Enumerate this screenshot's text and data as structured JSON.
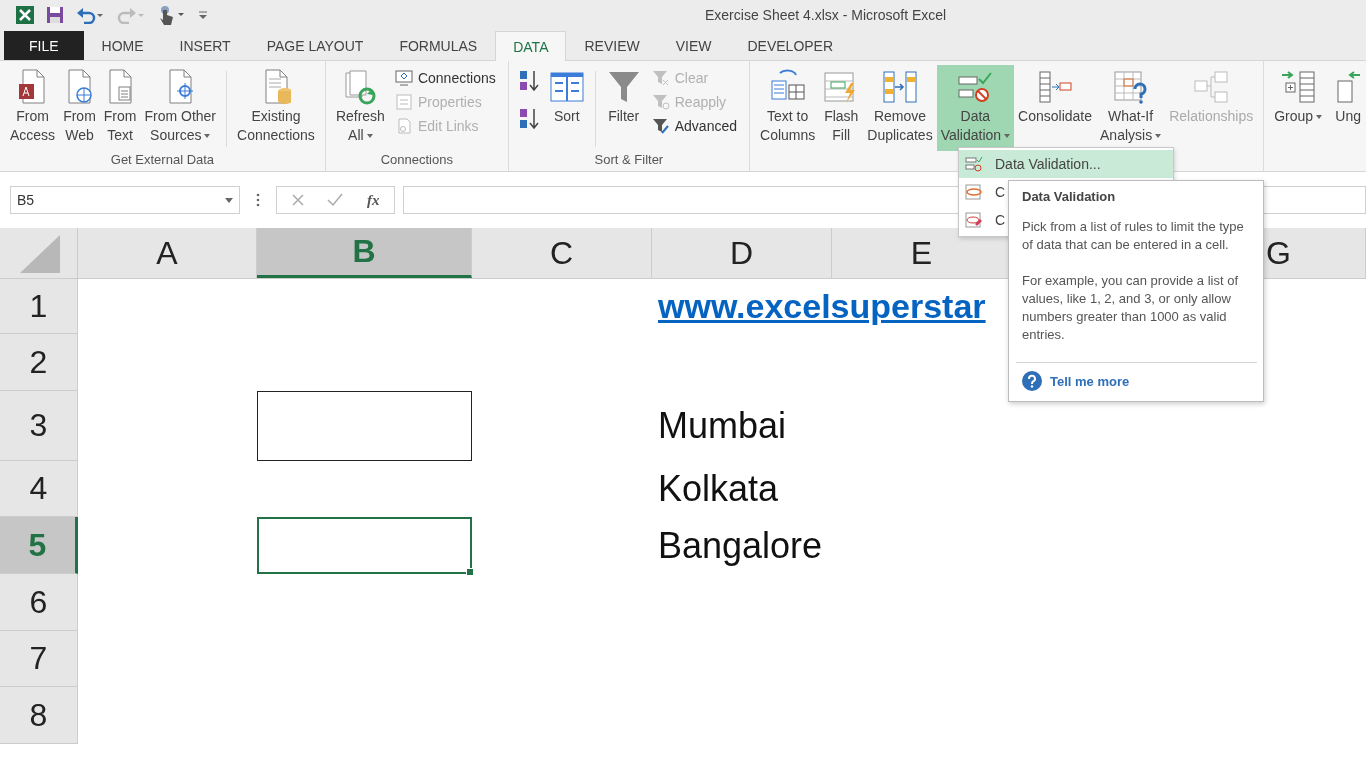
{
  "window": {
    "title": "Exercise Sheet 4.xlsx - Microsoft Excel"
  },
  "tabs": [
    {
      "label": "FILE",
      "kind": "file",
      "selected": false
    },
    {
      "label": "HOME",
      "kind": "tab",
      "selected": false
    },
    {
      "label": "INSERT",
      "kind": "tab",
      "selected": false
    },
    {
      "label": "PAGE LAYOUT",
      "kind": "tab",
      "selected": false
    },
    {
      "label": "FORMULAS",
      "kind": "tab",
      "selected": false
    },
    {
      "label": "DATA",
      "kind": "tab",
      "selected": true
    },
    {
      "label": "REVIEW",
      "kind": "tab",
      "selected": false
    },
    {
      "label": "VIEW",
      "kind": "tab",
      "selected": false
    },
    {
      "label": "DEVELOPER",
      "kind": "tab",
      "selected": false
    }
  ],
  "ribbon": {
    "groups": [
      {
        "label": "Get External Data",
        "items": [
          {
            "kind": "large",
            "lines": [
              "From",
              "Access"
            ],
            "dropdown": false,
            "disabled": false,
            "pressed": false
          },
          {
            "kind": "large",
            "lines": [
              "From",
              "Web"
            ],
            "dropdown": false,
            "disabled": false,
            "pressed": false
          },
          {
            "kind": "large",
            "lines": [
              "From",
              "Text"
            ],
            "dropdown": false,
            "disabled": false,
            "pressed": false
          },
          {
            "kind": "large",
            "lines": [
              "From Other",
              "Sources"
            ],
            "dropdown": true,
            "disabled": false,
            "pressed": false
          },
          {
            "kind": "divider"
          },
          {
            "kind": "large",
            "lines": [
              "Existing",
              "Connections"
            ],
            "dropdown": false,
            "disabled": false,
            "pressed": false
          }
        ]
      },
      {
        "label": "Connections",
        "items": [
          {
            "kind": "large",
            "lines": [
              "Refresh",
              "All"
            ],
            "dropdown": true,
            "disabled": false,
            "pressed": false
          },
          {
            "kind": "stack",
            "buttons": [
              {
                "label": "Connections",
                "disabled": false
              },
              {
                "label": "Properties",
                "disabled": true
              },
              {
                "label": "Edit Links",
                "disabled": true
              }
            ]
          }
        ]
      },
      {
        "label": "Sort & Filter",
        "items": [
          {
            "kind": "sort-pair"
          },
          {
            "kind": "large",
            "lines": [
              "Sort"
            ],
            "dropdown": false,
            "disabled": false,
            "pressed": false
          },
          {
            "kind": "divider"
          },
          {
            "kind": "large",
            "lines": [
              "Filter"
            ],
            "dropdown": false,
            "disabled": false,
            "pressed": false
          },
          {
            "kind": "stack",
            "buttons": [
              {
                "label": "Clear",
                "disabled": true
              },
              {
                "label": "Reapply",
                "disabled": true
              },
              {
                "label": "Advanced",
                "disabled": false
              }
            ]
          }
        ]
      },
      {
        "items": [
          {
            "kind": "large",
            "lines": [
              "Text to",
              "Columns"
            ],
            "dropdown": false,
            "disabled": false,
            "pressed": false
          },
          {
            "kind": "large",
            "lines": [
              "Flash",
              "Fill"
            ],
            "dropdown": false,
            "disabled": false,
            "pressed": false
          },
          {
            "kind": "large",
            "lines": [
              "Remove",
              "Duplicates"
            ],
            "dropdown": false,
            "disabled": false,
            "pressed": false
          },
          {
            "kind": "large",
            "lines": [
              "Data",
              "Validation"
            ],
            "dropdown": true,
            "disabled": false,
            "pressed": true
          },
          {
            "kind": "large",
            "lines": [
              "Consolidate"
            ],
            "dropdown": false,
            "disabled": false,
            "pressed": false
          },
          {
            "kind": "large",
            "lines": [
              "What-If",
              "Analysis"
            ],
            "dropdown": true,
            "disabled": false,
            "pressed": false
          },
          {
            "kind": "large",
            "lines": [
              "Relationships"
            ],
            "dropdown": false,
            "disabled": true,
            "pressed": false
          }
        ]
      },
      {
        "items": [
          {
            "kind": "large",
            "lines": [
              "Group"
            ],
            "dropdown": true,
            "disabled": false,
            "pressed": false
          },
          {
            "kind": "large",
            "lines": [
              "Ung"
            ],
            "dropdown": false,
            "disabled": false,
            "pressed": false
          }
        ]
      }
    ]
  },
  "formula_bar": {
    "name_box": "B5",
    "function_label": "fx"
  },
  "sheet": {
    "columns": [
      {
        "label": "A",
        "selected": false
      },
      {
        "label": "B",
        "selected": true
      },
      {
        "label": "C",
        "selected": false
      },
      {
        "label": "D",
        "selected": false
      },
      {
        "label": "E",
        "selected": false
      },
      {
        "label": "G",
        "selected": false
      }
    ],
    "rows": [
      {
        "label": "1",
        "selected": false,
        "cells": [
          {
            "kind": "empty"
          },
          {
            "kind": "empty"
          },
          {
            "kind": "empty"
          },
          {
            "text": "www.excelsuperstar",
            "kind": "link",
            "selected": false
          }
        ]
      },
      {
        "label": "2",
        "selected": false,
        "cells": []
      },
      {
        "label": "3",
        "selected": false,
        "cells": [
          {
            "kind": "empty"
          },
          {
            "kind": "boxed",
            "selected": false
          },
          {
            "kind": "empty"
          },
          {
            "text": "Mumbai",
            "kind": "text",
            "selected": false
          }
        ]
      },
      {
        "label": "4",
        "selected": false,
        "cells": [
          {
            "kind": "empty"
          },
          {
            "kind": "empty"
          },
          {
            "kind": "empty"
          },
          {
            "text": "Kolkata",
            "kind": "text",
            "selected": false
          }
        ]
      },
      {
        "label": "5",
        "selected": true,
        "cells": [
          {
            "kind": "empty"
          },
          {
            "kind": "boxed",
            "selected": true
          },
          {
            "kind": "empty"
          },
          {
            "text": "Bangalore",
            "kind": "text",
            "selected": false
          }
        ]
      },
      {
        "label": "6",
        "selected": false,
        "cells": []
      },
      {
        "label": "7",
        "selected": false,
        "cells": []
      },
      {
        "label": "8",
        "selected": false,
        "cells": []
      }
    ]
  },
  "dropdown_menu": {
    "items": [
      {
        "label": "Data Validation...",
        "highlighted": true
      },
      {
        "label": "C",
        "highlighted": false
      },
      {
        "label": "C",
        "highlighted": false
      }
    ]
  },
  "tooltip": {
    "title": "Data Validation",
    "paragraphs": [
      "Pick from a list of rules to limit the type of data that can be entered in a cell.",
      "For example, you can provide a list of values, like 1, 2, and 3, or only allow numbers greater than 1000 as valid entries."
    ],
    "link": "Tell me more"
  }
}
